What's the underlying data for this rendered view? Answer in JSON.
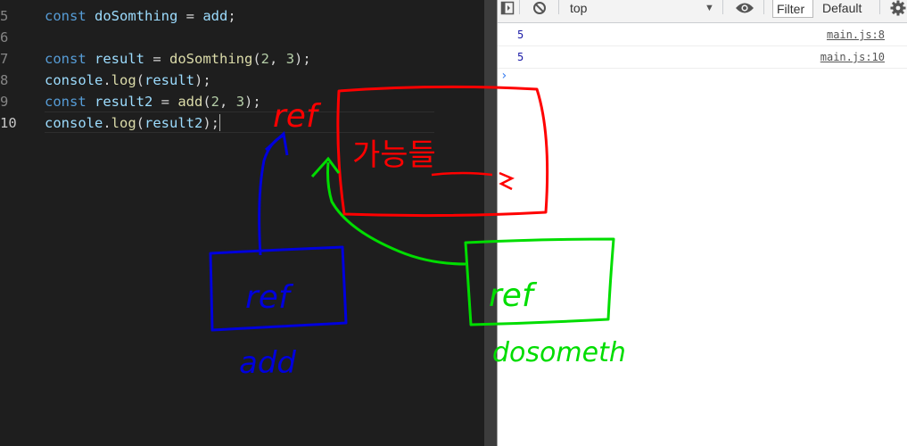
{
  "editor": {
    "lines": [
      {
        "num": "5",
        "tokens": [
          {
            "t": "const ",
            "c": "kw"
          },
          {
            "t": "doSomthing",
            "c": "id"
          },
          {
            "t": " = ",
            "c": "p"
          },
          {
            "t": "add",
            "c": "id"
          },
          {
            "t": ";",
            "c": "p"
          }
        ]
      },
      {
        "num": "6",
        "tokens": []
      },
      {
        "num": "7",
        "tokens": [
          {
            "t": "const ",
            "c": "kw"
          },
          {
            "t": "result",
            "c": "id"
          },
          {
            "t": " = ",
            "c": "p"
          },
          {
            "t": "doSomthing",
            "c": "fn"
          },
          {
            "t": "(",
            "c": "p"
          },
          {
            "t": "2",
            "c": "num"
          },
          {
            "t": ", ",
            "c": "p"
          },
          {
            "t": "3",
            "c": "num"
          },
          {
            "t": ");",
            "c": "p"
          }
        ]
      },
      {
        "num": "8",
        "tokens": [
          {
            "t": "console",
            "c": "id"
          },
          {
            "t": ".",
            "c": "p"
          },
          {
            "t": "log",
            "c": "fn"
          },
          {
            "t": "(",
            "c": "p"
          },
          {
            "t": "result",
            "c": "id"
          },
          {
            "t": ");",
            "c": "p"
          }
        ]
      },
      {
        "num": "9",
        "tokens": [
          {
            "t": "const ",
            "c": "kw"
          },
          {
            "t": "result2",
            "c": "id"
          },
          {
            "t": " = ",
            "c": "p"
          },
          {
            "t": "add",
            "c": "fn"
          },
          {
            "t": "(",
            "c": "p"
          },
          {
            "t": "2",
            "c": "num"
          },
          {
            "t": ", ",
            "c": "p"
          },
          {
            "t": "3",
            "c": "num"
          },
          {
            "t": ");",
            "c": "p"
          }
        ]
      },
      {
        "num": "10",
        "tokens": [
          {
            "t": "console",
            "c": "id"
          },
          {
            "t": ".",
            "c": "p"
          },
          {
            "t": "log",
            "c": "fn"
          },
          {
            "t": "(",
            "c": "p"
          },
          {
            "t": "result2",
            "c": "id"
          },
          {
            "t": ");",
            "c": "p"
          }
        ],
        "active": true
      }
    ]
  },
  "devtools": {
    "context": "top",
    "filter_placeholder": "Filter",
    "levels_label": "Default",
    "messages": [
      {
        "value": "5",
        "source": "main.js:8"
      },
      {
        "value": "5",
        "source": "main.js:10"
      }
    ],
    "prompt_symbol": "›",
    "icons": [
      "sidebar-toggle-icon",
      "clear-console-icon",
      "eye-icon",
      "gear-icon"
    ]
  },
  "annotations": {
    "red_label": "ref",
    "red_box_text": "가능들",
    "blue_box_text": "ref",
    "blue_caption": "add",
    "green_box_text": "ref",
    "green_caption": "dosometh",
    "colors": {
      "red": "#ff0000",
      "blue": "#0000dd",
      "green": "#00dd00"
    }
  }
}
